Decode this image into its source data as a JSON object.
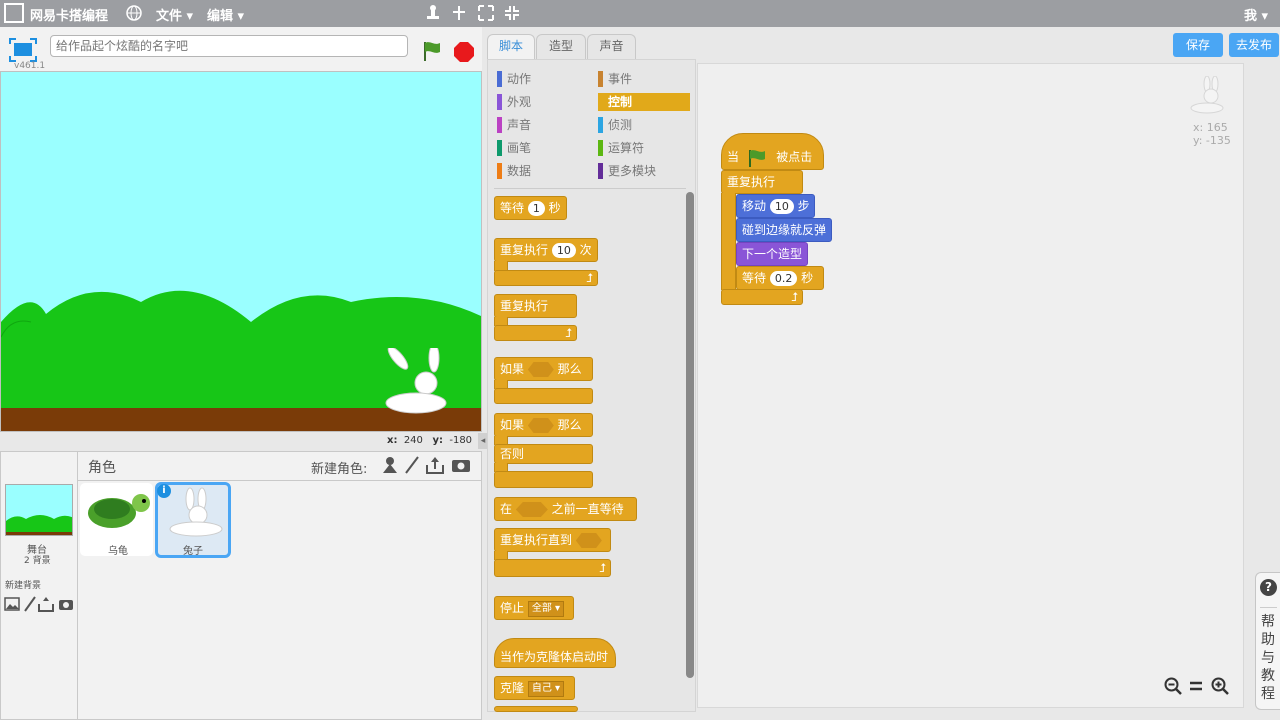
{
  "menu": {
    "title": "网易卡搭编程",
    "file": "文件",
    "edit": "编辑",
    "user": "我"
  },
  "stage": {
    "title_placeholder": "给作品起个炫酷的名字吧",
    "version": "v461.1",
    "x_label": "x:",
    "x_value": "240",
    "y_label": "y:",
    "y_value": "-180"
  },
  "sprites": {
    "header": "角色",
    "new_sprite": "新建角色:",
    "stage_label": "舞台",
    "stage_sub": "2 背景",
    "new_backdrop": "新建背景",
    "items": [
      {
        "label": "乌龟"
      },
      {
        "label": "兔子"
      }
    ]
  },
  "tabs": [
    "脚本",
    "造型",
    "声音"
  ],
  "categories_left": [
    "动作",
    "外观",
    "声音",
    "画笔",
    "数据"
  ],
  "categories_right": [
    "事件",
    "控制",
    "侦测",
    "运算符",
    "更多模块"
  ],
  "category_colors": {
    "动作": "#4a6cd4",
    "外观": "#8a55d7",
    "声音": "#bb42c3",
    "画笔": "#0e9a6c",
    "数据": "#ee7d16",
    "事件": "#c88330",
    "控制": "#e1a91a",
    "侦测": "#2ca5e2",
    "运算符": "#5cb712",
    "更多模块": "#632d99"
  },
  "palette": {
    "wait": {
      "pre": "等待",
      "val": "1",
      "post": "秒"
    },
    "repeat": {
      "pre": "重复执行",
      "val": "10",
      "post": "次"
    },
    "forever": "重复执行",
    "if": {
      "pre": "如果",
      "post": "那么"
    },
    "ifelse": {
      "pre": "如果",
      "post": "那么",
      "else": "否则"
    },
    "waituntil": {
      "pre": "在",
      "post": "之前一直等待"
    },
    "repeatuntil": "重复执行直到",
    "stop": {
      "pre": "停止",
      "opt": "全部"
    },
    "clonestart": "当作为克隆体启动时",
    "clone": {
      "pre": "克隆",
      "opt": "自己"
    }
  },
  "script": {
    "hat": {
      "pre": "当",
      "post": "被点击"
    },
    "forever": "重复执行",
    "move": {
      "pre": "移动",
      "val": "10",
      "post": "步"
    },
    "bounce": "碰到边缘就反弹",
    "nextcostume": "下一个造型",
    "wait": {
      "pre": "等待",
      "val": "0.2",
      "post": "秒"
    }
  },
  "sprite_info": {
    "x": "x: 165",
    "y": "y: -135"
  },
  "buttons": {
    "save": "保存",
    "publish": "去发布"
  },
  "help": {
    "icon": "?",
    "chars": [
      "帮",
      "助",
      "与",
      "教",
      "程"
    ]
  }
}
